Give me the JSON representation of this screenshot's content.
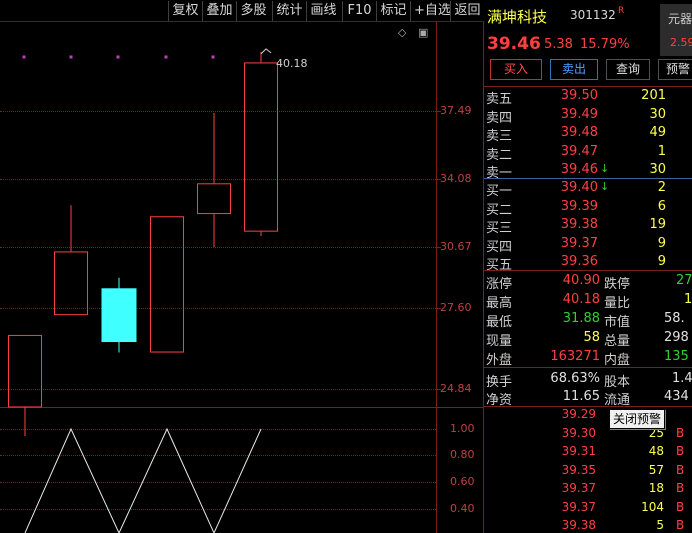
{
  "toolbar": {
    "buttons": [
      "复权",
      "叠加",
      "多股",
      "统计",
      "画线",
      "F10",
      "标记",
      "+自选",
      "返回"
    ]
  },
  "chart": {
    "y_ticks": [
      "37.49",
      "34.08",
      "30.67",
      "27.60",
      "24.84"
    ],
    "indicator_ticks": [
      "1.00",
      "0.80",
      "0.60",
      "0.40"
    ],
    "high_label": "40.18",
    "colors": {
      "up": "#ff4040",
      "down": "#40ffff",
      "grid": "#6a2a2a"
    }
  },
  "chart_data": {
    "type": "candlestick",
    "ylim": [
      22.5,
      41.5
    ],
    "candles": [
      {
        "open": 24.0,
        "close": 27.3,
        "high": 27.3,
        "low": 22.7
      },
      {
        "open": 28.2,
        "close": 31.1,
        "high": 33.2,
        "low": 28.2
      },
      {
        "open": 29.4,
        "close": 27.0,
        "high": 29.9,
        "low": 26.5
      },
      {
        "open": 26.5,
        "close": 32.7,
        "high": 32.7,
        "low": 26.5
      },
      {
        "open": 32.8,
        "close": 34.2,
        "high": 37.4,
        "low": 31.3
      },
      {
        "open": 32.0,
        "close": 39.7,
        "high": 40.18,
        "low": 31.8
      }
    ],
    "indicator": {
      "ylim": [
        0,
        1.1
      ],
      "points": [
        [
          0,
          0.0
        ],
        [
          1,
          1.0
        ],
        [
          2,
          0.0
        ],
        [
          3,
          1.0
        ],
        [
          4,
          0.0
        ],
        [
          5,
          1.0
        ]
      ]
    }
  },
  "stock": {
    "name": "满坤科技",
    "code": "301132",
    "badge": "R",
    "side_box_top": "元器",
    "side_box_bottom": "2.59",
    "price": "39.46",
    "change": "5.38",
    "pct": "15.79%"
  },
  "actions": {
    "buy": "买入",
    "sell": "卖出",
    "query": "查询",
    "warn": "预警"
  },
  "order_book": {
    "asks": [
      {
        "label": "卖五",
        "price": "39.50",
        "vol": "201",
        "arrow": ""
      },
      {
        "label": "卖四",
        "price": "39.49",
        "vol": "30",
        "arrow": ""
      },
      {
        "label": "卖三",
        "price": "39.48",
        "vol": "49",
        "arrow": ""
      },
      {
        "label": "卖二",
        "price": "39.47",
        "vol": "1",
        "arrow": ""
      },
      {
        "label": "卖一",
        "price": "39.46",
        "vol": "30",
        "arrow": "↓"
      }
    ],
    "bids": [
      {
        "label": "买一",
        "price": "39.40",
        "vol": "2",
        "arrow": "↓"
      },
      {
        "label": "买二",
        "price": "39.39",
        "vol": "6",
        "arrow": ""
      },
      {
        "label": "买三",
        "price": "39.38",
        "vol": "19",
        "arrow": ""
      },
      {
        "label": "买四",
        "price": "39.37",
        "vol": "9",
        "arrow": ""
      },
      {
        "label": "买五",
        "price": "39.36",
        "vol": "9",
        "arrow": ""
      }
    ]
  },
  "stats": {
    "limit_up_label": "涨停",
    "limit_up": "40.90",
    "limit_down_label": "跌停",
    "limit_down": "27",
    "high_label": "最高",
    "high": "40.18",
    "ratio_label": "量比",
    "ratio": "1",
    "low_label": "最低",
    "low": "31.88",
    "mcap_label": "市值",
    "mcap": "58.",
    "now_label": "现量",
    "now": "58",
    "total_label": "总量",
    "total": "298",
    "outer_label": "外盘",
    "outer": "163271",
    "inner_label": "内盘",
    "inner": "135",
    "turnover_label": "换手",
    "turnover": "68.63%",
    "equity_label": "股本",
    "equity": "1.4",
    "nav_label": "净资",
    "nav": "11.65",
    "float_label": "流通",
    "float": "434"
  },
  "trades": [
    {
      "price": "39.29",
      "vol": "",
      "dir": ""
    },
    {
      "price": "39.30",
      "vol": "25",
      "dir": "B"
    },
    {
      "price": "39.31",
      "vol": "48",
      "dir": "B"
    },
    {
      "price": "39.35",
      "vol": "57",
      "dir": "B"
    },
    {
      "price": "39.37",
      "vol": "18",
      "dir": "B"
    },
    {
      "price": "39.37",
      "vol": "104",
      "dir": "B"
    },
    {
      "price": "39.38",
      "vol": "5",
      "dir": "B"
    }
  ],
  "tooltip": {
    "text": "关闭预警"
  }
}
